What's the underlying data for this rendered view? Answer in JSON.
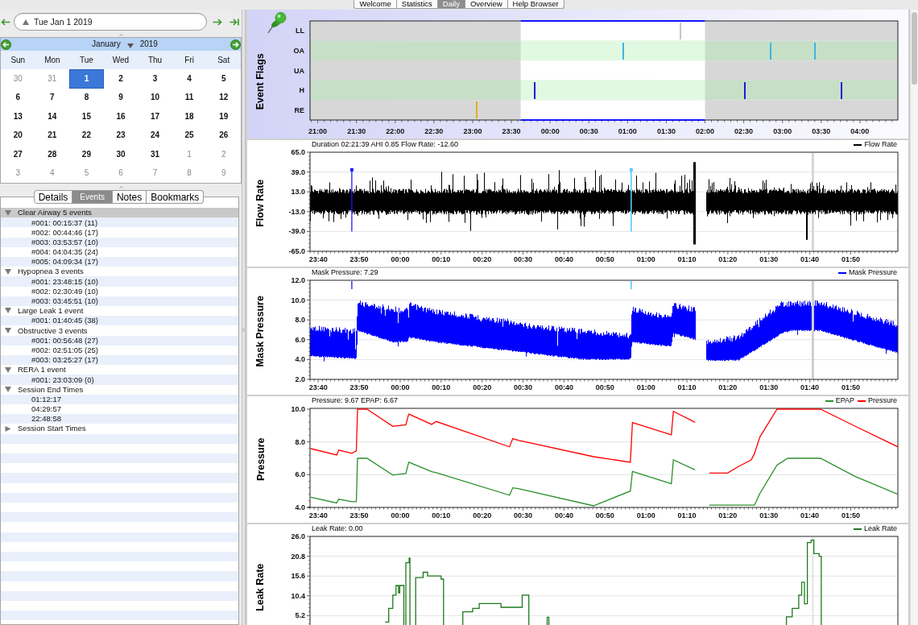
{
  "app_tabs": [
    {
      "label": "Welcome",
      "selected": false
    },
    {
      "label": "Statistics",
      "selected": false
    },
    {
      "label": "Daily",
      "selected": true
    },
    {
      "label": "Overview",
      "selected": false
    },
    {
      "label": "Help Browser",
      "selected": false
    }
  ],
  "date_bar": {
    "value": "Tue Jan 1 2019"
  },
  "calendar": {
    "month": "January",
    "year": "2019",
    "weekdays": [
      "Sun",
      "Mon",
      "Tue",
      "Wed",
      "Thu",
      "Fri",
      "Sat"
    ],
    "weeks": [
      [
        {
          "day": "30",
          "in_month": false,
          "selected": false
        },
        {
          "day": "31",
          "in_month": false,
          "selected": false
        },
        {
          "day": "1",
          "in_month": true,
          "selected": true
        },
        {
          "day": "2",
          "in_month": true,
          "selected": false
        },
        {
          "day": "3",
          "in_month": true,
          "selected": false
        },
        {
          "day": "4",
          "in_month": true,
          "selected": false
        },
        {
          "day": "5",
          "in_month": true,
          "selected": false
        }
      ],
      [
        {
          "day": "6",
          "in_month": true,
          "selected": false
        },
        {
          "day": "7",
          "in_month": true,
          "selected": false
        },
        {
          "day": "8",
          "in_month": true,
          "selected": false
        },
        {
          "day": "9",
          "in_month": true,
          "selected": false
        },
        {
          "day": "10",
          "in_month": true,
          "selected": false
        },
        {
          "day": "11",
          "in_month": true,
          "selected": false
        },
        {
          "day": "12",
          "in_month": true,
          "selected": false
        }
      ],
      [
        {
          "day": "13",
          "in_month": true,
          "selected": false
        },
        {
          "day": "14",
          "in_month": true,
          "selected": false
        },
        {
          "day": "15",
          "in_month": true,
          "selected": false
        },
        {
          "day": "16",
          "in_month": true,
          "selected": false
        },
        {
          "day": "17",
          "in_month": true,
          "selected": false
        },
        {
          "day": "18",
          "in_month": true,
          "selected": false
        },
        {
          "day": "19",
          "in_month": true,
          "selected": false
        }
      ],
      [
        {
          "day": "20",
          "in_month": true,
          "selected": false
        },
        {
          "day": "21",
          "in_month": true,
          "selected": false
        },
        {
          "day": "22",
          "in_month": true,
          "selected": false
        },
        {
          "day": "23",
          "in_month": true,
          "selected": false
        },
        {
          "day": "24",
          "in_month": true,
          "selected": false
        },
        {
          "day": "25",
          "in_month": true,
          "selected": false
        },
        {
          "day": "26",
          "in_month": true,
          "selected": false
        }
      ],
      [
        {
          "day": "27",
          "in_month": true,
          "selected": false
        },
        {
          "day": "28",
          "in_month": true,
          "selected": false
        },
        {
          "day": "29",
          "in_month": true,
          "selected": false
        },
        {
          "day": "30",
          "in_month": true,
          "selected": false
        },
        {
          "day": "31",
          "in_month": true,
          "selected": false
        },
        {
          "day": "1",
          "in_month": false,
          "selected": false
        },
        {
          "day": "2",
          "in_month": false,
          "selected": false
        }
      ],
      [
        {
          "day": "3",
          "in_month": false,
          "selected": false
        },
        {
          "day": "4",
          "in_month": false,
          "selected": false
        },
        {
          "day": "5",
          "in_month": false,
          "selected": false
        },
        {
          "day": "6",
          "in_month": false,
          "selected": false
        },
        {
          "day": "7",
          "in_month": false,
          "selected": false
        },
        {
          "day": "8",
          "in_month": false,
          "selected": false
        },
        {
          "day": "9",
          "in_month": false,
          "selected": false
        }
      ]
    ]
  },
  "sidebar_tabs": [
    {
      "label": "Details",
      "selected": false
    },
    {
      "label": "Events",
      "selected": true
    },
    {
      "label": "Notes",
      "selected": false
    },
    {
      "label": "Bookmarks",
      "selected": false
    }
  ],
  "event_tree": [
    {
      "label": "Clear Airway 5 events",
      "expanded": true,
      "selected": true,
      "children": [
        {
          "label": "#001: 00:15:37 (11)",
          "selected": false
        },
        {
          "label": "#002: 00:44:46 (17)",
          "selected": false
        },
        {
          "label": "#003: 03:53:57 (10)",
          "selected": false
        },
        {
          "label": "#004: 04:04:35 (24)",
          "selected": false
        },
        {
          "label": "#005: 04:09:34 (17)",
          "selected": false
        }
      ]
    },
    {
      "label": "Hypopnea 3 events",
      "expanded": true,
      "selected": false,
      "children": [
        {
          "label": "#001: 23:48:15 (10)",
          "selected": false
        },
        {
          "label": "#002: 02:30:49 (10)",
          "selected": false
        },
        {
          "label": "#003: 03:45:51 (10)",
          "selected": false
        }
      ]
    },
    {
      "label": "Large Leak 1 event",
      "expanded": true,
      "selected": false,
      "children": [
        {
          "label": "#001: 01:40:45 (38)",
          "selected": false
        }
      ]
    },
    {
      "label": "Obstructive 3 events",
      "expanded": true,
      "selected": false,
      "children": [
        {
          "label": "#001: 00:56:48 (27)",
          "selected": false
        },
        {
          "label": "#002: 02:51:05 (25)",
          "selected": false
        },
        {
          "label": "#003: 03:25:27 (17)",
          "selected": false
        }
      ]
    },
    {
      "label": "RERA 1 event",
      "expanded": true,
      "selected": false,
      "children": [
        {
          "label": "#001: 23:03:09 (0)",
          "selected": false
        }
      ]
    },
    {
      "label": "Session End Times",
      "expanded": true,
      "selected": false,
      "children": [
        {
          "label": "01:12:17",
          "selected": false
        },
        {
          "label": "04:29:57",
          "selected": false
        },
        {
          "label": "22:48:58",
          "selected": false
        }
      ]
    },
    {
      "label": "Session Start Times",
      "expanded": false,
      "selected": false
    }
  ],
  "charts": [
    {
      "kind": "flags",
      "title": "Event Flags",
      "rows": [
        {
          "label": "LL",
          "color": "#c8c8c8"
        },
        {
          "label": "OA",
          "color": "#3cb4e6"
        },
        {
          "label": "UA"
        },
        {
          "label": "H",
          "color": "#1c1cd8"
        },
        {
          "label": "RE",
          "color": "#e0b020"
        }
      ],
      "x_labels": [
        "21:00",
        "21:30",
        "22:00",
        "22:30",
        "23:00",
        "23:30",
        "00:00",
        "00:30",
        "01:00",
        "01:30",
        "02:00",
        "02:30",
        "03:00",
        "03:30",
        "04:00"
      ]
    },
    {
      "kind": "wave",
      "title": "Flow Rate",
      "info": "Duration 02:21:39 AHI 0.85 Flow Rate: -12.60",
      "legend": [
        {
          "name": "Flow Rate",
          "color": "#000000"
        }
      ],
      "y_labels": [
        "65.0",
        "39.0",
        "13.0",
        "-13.0",
        "-39.0",
        "-65.0"
      ],
      "x_labels": [
        "23:40",
        "23:50",
        "00:00",
        "00:10",
        "00:20",
        "00:30",
        "00:40",
        "00:50",
        "01:00",
        "01:10",
        "01:20",
        "01:30",
        "01:40",
        "01:50"
      ]
    },
    {
      "kind": "band",
      "title": "Mask Pressure",
      "info": "Mask Pressure: 7.29",
      "legend": [
        {
          "name": "Mask Pressure",
          "color": "#0000ff"
        }
      ],
      "y_labels": [
        "12.0",
        "10.0",
        "8.0",
        "6.0",
        "4.0",
        "2.0"
      ],
      "x_labels": [
        "23:40",
        "23:50",
        "00:00",
        "00:10",
        "00:20",
        "00:30",
        "00:40",
        "00:50",
        "01:00",
        "01:10",
        "01:20",
        "01:30",
        "01:40",
        "01:50"
      ]
    },
    {
      "kind": "line",
      "info": "Pressure: 9.67 EPAP: 6.67",
      "chart_data": {
        "type": "line",
        "title": "Pressure",
        "legend": "upper right",
        "grid": true,
        "x": [
          "2019-01-01T23:38:12",
          "2019-01-01T23:44:30",
          "2019-01-01T23:45:00",
          "2019-01-01T23:48:12",
          "2019-01-01T23:49:18",
          "2019-01-01T23:49:36",
          "2019-01-01T23:51:54",
          "2019-01-01T23:58:12",
          "2019-01-02T00:01:24",
          "2019-01-02T00:02:06",
          "2019-01-02T00:07:42",
          "2019-01-02T00:08:48",
          "2019-01-02T00:26:42",
          "2019-01-02T00:27:30",
          "2019-01-02T00:28:48",
          "2019-01-02T00:47:12",
          "2019-01-02T00:56:12",
          "2019-01-02T00:56:42",
          "2019-01-02T01:06:12",
          "2019-01-02T01:06:42",
          "2019-01-02T01:12:00",
          "2019-01-02T01:13:30",
          "2019-01-02T01:15:30",
          "2019-01-02T01:19:54",
          "2019-01-02T01:22:36",
          "2019-01-02T01:25:42",
          "2019-01-02T01:26:30",
          "2019-01-02T01:27:48",
          "2019-01-02T01:32:00",
          "2019-01-02T01:34:36",
          "2019-01-02T01:42:36",
          "2019-01-02T01:51:00",
          "2019-01-02T02:01:30"
        ],
        "series": [
          {
            "name": "EPAP",
            "color": "#2a8f2a",
            "values": [
              4.62,
              4.27,
              4.5,
              4.35,
              4.35,
              7.0,
              7.0,
              5.97,
              6.07,
              6.76,
              6.18,
              6.12,
              4.75,
              5.2,
              5.15,
              4.1,
              5.0,
              6.2,
              5.44,
              6.9,
              6.29,
              null,
              4.14,
              4.14,
              4.14,
              4.14,
              4.14,
              4.85,
              6.58,
              7.0,
              7.0,
              5.9,
              4.8
            ]
          },
          {
            "name": "Pressure",
            "color": "#ff0000",
            "values": [
              7.59,
              7.2,
              7.5,
              7.3,
              7.45,
              10.0,
              10.0,
              8.95,
              9.05,
              9.7,
              9.07,
              9.25,
              7.7,
              8.2,
              8.1,
              7.1,
              6.76,
              9.18,
              8.43,
              9.87,
              9.2,
              null,
              6.1,
              6.1,
              6.5,
              6.9,
              7.3,
              8.3,
              10.0,
              10.0,
              10.0,
              8.97,
              7.7
            ]
          }
        ],
        "xlim": [
          "2019-01-01T23:38:00",
          "2019-01-02T02:01:30"
        ],
        "ylim": [
          4,
          10.05
        ],
        "xticks": [
          {
            "value": "2019-01-01T23:40:00",
            "label": "23:40"
          },
          {
            "value": "2019-01-01T23:50:00",
            "label": "23:50"
          },
          {
            "value": "2019-01-02T00:00:00",
            "label": "00:00"
          },
          {
            "value": "2019-01-02T00:10:00",
            "label": "00:10"
          },
          {
            "value": "2019-01-02T00:20:00",
            "label": "00:20"
          },
          {
            "value": "2019-01-02T00:30:00",
            "label": "00:30"
          },
          {
            "value": "2019-01-02T00:40:00",
            "label": "00:40"
          },
          {
            "value": "2019-01-02T00:50:00",
            "label": "00:50"
          },
          {
            "value": "2019-01-02T01:00:00",
            "label": "01:00"
          },
          {
            "value": "2019-01-02T01:10:00",
            "label": "01:10"
          },
          {
            "value": "2019-01-02T01:20:00",
            "label": "01:20"
          },
          {
            "value": "2019-01-02T01:30:00",
            "label": "01:30"
          },
          {
            "value": "2019-01-02T01:40:00",
            "label": "01:40"
          },
          {
            "value": "2019-01-02T01:50:00",
            "label": "01:50"
          }
        ],
        "yticks": [
          {
            "value": 4,
            "label": "4.0"
          },
          {
            "value": 6,
            "label": "6.0"
          },
          {
            "value": 8,
            "label": "8.0"
          },
          {
            "value": 10,
            "label": "10.0"
          }
        ]
      }
    },
    {
      "kind": "line",
      "info": "Leak Rate: 0.00",
      "chart_data": {
        "type": "line",
        "title": "Leak Rate",
        "legend": "upper right",
        "grid": true,
        "x": [
          "2019-01-01T23:56:18",
          "2019-01-01T23:57:12",
          "2019-01-01T23:57:12",
          "2019-01-01T23:58:12",
          "2019-01-01T23:58:12",
          "2019-01-01T23:59:00",
          "2019-01-01T23:59:00",
          "2019-01-01T23:59:36",
          "2019-01-01T23:59:36",
          "2019-01-01T23:59:54",
          "2019-01-01T23:59:54",
          "2019-01-02T00:00:54",
          "2019-01-02T00:00:54",
          "2019-01-02T00:01:09",
          "2019-01-02T00:01:24",
          "2019-01-02T00:01:24",
          "2019-01-02T00:02:12",
          "2019-01-02T00:02:12",
          "2019-01-02T00:02:24",
          "2019-01-02T00:02:24",
          "2019-01-02T00:03:06",
          "2019-01-02T00:03:48",
          "2019-01-02T00:03:48",
          "2019-01-02T00:05:36",
          "2019-01-02T00:05:36",
          "2019-01-02T00:06:42",
          "2019-01-02T00:06:42",
          "2019-01-02T00:10:00",
          "2019-01-02T00:10:00",
          "2019-01-02T00:10:36",
          "2019-01-02T00:10:36",
          "2019-01-02T00:13:00",
          "2019-01-02T00:15:18",
          "2019-01-02T00:15:18",
          "2019-01-02T00:17:42",
          "2019-01-02T00:17:42",
          "2019-01-02T00:19:18",
          "2019-01-02T00:19:18",
          "2019-01-02T00:24:36",
          "2019-01-02T00:24:36",
          "2019-01-02T00:29:48",
          "2019-01-02T00:29:48",
          "2019-01-02T00:31:24",
          "2019-01-02T00:31:24",
          "2019-01-02T00:33:36",
          "2019-01-02T00:35:54",
          "2019-01-02T00:35:54",
          "2019-01-02T00:36:18",
          "2019-01-02T00:36:18",
          "2019-01-02T01:05:00",
          "2019-01-02T01:34:18",
          "2019-01-02T01:34:18",
          "2019-01-02T01:35:42",
          "2019-01-02T01:35:42",
          "2019-01-02T01:37:18",
          "2019-01-02T01:37:18",
          "2019-01-02T01:38:00",
          "2019-01-02T01:38:00",
          "2019-01-02T01:38:42",
          "2019-01-02T01:38:42",
          "2019-01-02T01:39:24",
          "2019-01-02T01:39:24",
          "2019-01-02T01:40:18",
          "2019-01-02T01:40:18",
          "2019-01-02T01:41:00",
          "2019-01-02T01:41:00",
          "2019-01-02T01:42:18",
          "2019-01-02T01:42:18",
          "2019-01-02T01:42:48",
          "2019-01-02T01:42:48"
        ],
        "series": [
          {
            "name": "Leak Rate",
            "color": "#1e7a1e",
            "values": [
              3.5,
              3.5,
              7.1,
              7.1,
              10.6,
              10.6,
              13.1,
              13.1,
              11.2,
              11.2,
              13.1,
              13.1,
              0,
              null,
              0,
              19.1,
              19.1,
              20.3,
              20.3,
              0,
              null,
              0,
              15.2,
              15.2,
              16.6,
              16.6,
              15.6,
              15.6,
              14.8,
              14.8,
              0,
              null,
              0,
              6.2,
              6.2,
              7.1,
              7.1,
              8.4,
              8.4,
              7.4,
              7.4,
              10.6,
              10.6,
              0,
              null,
              0,
              4.8,
              4.8,
              0,
              null,
              0,
              4.9,
              4.9,
              7.1,
              7.1,
              10.6,
              10.6,
              14.0,
              14.0,
              8.3,
              8.3,
              24.4,
              24.4,
              25.0,
              25.0,
              21.5,
              21.5,
              20.8,
              20.8,
              0
            ]
          }
        ],
        "ref_lines": [
          {
            "axis": "x",
            "value": "2019-01-02T01:40:45"
          }
        ],
        "xlim": [
          "2019-01-01T23:38:00",
          "2019-01-02T02:01:30"
        ],
        "ylim": [
          0,
          26
        ],
        "yticks": [
          {
            "value": 5.2,
            "label": "5.2"
          },
          {
            "value": 10.4,
            "label": "10.4"
          },
          {
            "value": 15.6,
            "label": "15.6"
          },
          {
            "value": 20.8,
            "label": "20.8"
          },
          {
            "value": 26,
            "label": "26.0"
          }
        ]
      }
    }
  ]
}
